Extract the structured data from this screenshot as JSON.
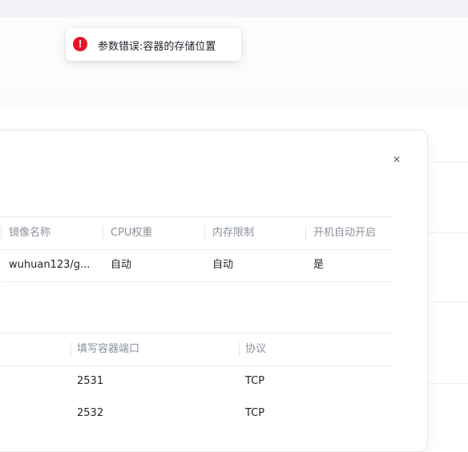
{
  "toast": {
    "icon": "error-icon",
    "icon_glyph": "!",
    "icon_color": "#e5152b",
    "message": "参数错误:容器的存储位置"
  },
  "modal": {
    "close_glyph": "×",
    "image_table": {
      "headers": [
        "镜像名称",
        "CPU权重",
        "内存限制",
        "开机自动开启"
      ],
      "rows": [
        [
          "wuhuan123/g...",
          "自动",
          "自动",
          "是"
        ]
      ]
    },
    "port_table": {
      "headers": [
        "填写容器端口",
        "协议"
      ],
      "rows": [
        [
          "2531",
          "TCP"
        ],
        [
          "2532",
          "TCP"
        ]
      ]
    }
  }
}
